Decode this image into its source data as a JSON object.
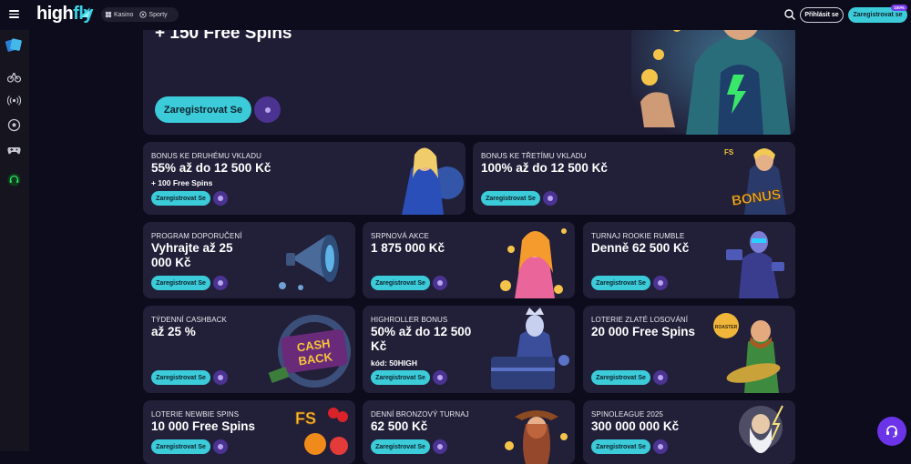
{
  "header": {
    "logo_main": "high",
    "logo_accent": "fly",
    "tabs": [
      {
        "label": "Kasino",
        "icon": "casino-icon"
      },
      {
        "label": "Sporty",
        "icon": "sports-icon"
      }
    ],
    "login_label": "Přihlásit se",
    "register_label": "Zaregistrovat se",
    "register_badge": "100%"
  },
  "sidebar": {
    "items": [
      {
        "icon": "cards-icon"
      },
      {
        "icon": "bicycle-icon"
      },
      {
        "icon": "live-signal-icon"
      },
      {
        "icon": "soccer-ball-icon"
      },
      {
        "icon": "gamepad-icon"
      },
      {
        "icon": "headset-icon"
      }
    ]
  },
  "hero": {
    "title": "+ 150 Free Spins",
    "button_label": "Zaregistrovat Se"
  },
  "promos": [
    {
      "tag": "BONUS KE DRUHÉMU VKLADU",
      "title": "55% až do 12 500 Kč",
      "sub": "+ 100 Free Spins",
      "button": "Zaregistrovat Se"
    },
    {
      "tag": "BONUS KE TŘETÍMU VKLADU",
      "title": "100% až do 12 500 Kč",
      "sub": "",
      "button": "Zaregistrovat Se"
    },
    {
      "tag": "PROGRAM DOPORUČENÍ",
      "title": "Vyhrajte až 25 000 Kč",
      "sub": "",
      "button": "Zaregistrovat Se"
    },
    {
      "tag": "SRPNOVÁ AKCE",
      "title": "1 875 000 Kč",
      "sub": "",
      "button": "Zaregistrovat Se"
    },
    {
      "tag": "TURNAJ ROOKIE RUMBLE",
      "title": "Denně 62 500 Kč",
      "sub": "",
      "button": "Zaregistrovat Se"
    },
    {
      "tag": "TÝDENNÍ CASHBACK",
      "title": "až 25 %",
      "sub": "",
      "button": "Zaregistrovat Se"
    },
    {
      "tag": "HIGHROLLER BONUS",
      "title": "50% až do 12 500 Kč",
      "sub": "kód: 50HIGH",
      "button": "Zaregistrovat Se"
    },
    {
      "tag": "LOTERIE ZLATÉ LOSOVÁNÍ",
      "title": "20 000 Free Spins",
      "sub": "",
      "button": "Zaregistrovat Se"
    },
    {
      "tag": "LOTERIE NEWBIE SPINS",
      "title": "10 000 Free Spins",
      "sub": "",
      "button": "Zaregistrovat Se"
    },
    {
      "tag": "DENNÍ BRONZOVÝ TURNAJ",
      "title": "62 500 Kč",
      "sub": "",
      "button": "Zaregistrovat Se"
    },
    {
      "tag": "SPINOLEAGUE 2025",
      "title": "300 000 000 Kč",
      "sub": "",
      "button": "Zaregistrovat Se"
    }
  ],
  "art_text": {
    "bonus": "BONUS",
    "cash": "CASH",
    "back": "BACK",
    "fs": "FS",
    "roaster": "ROASTER"
  },
  "colors": {
    "accent": "#3bcbd9",
    "info": "#4b3391",
    "card": "#221f38",
    "bg": "#0d0c1c"
  }
}
